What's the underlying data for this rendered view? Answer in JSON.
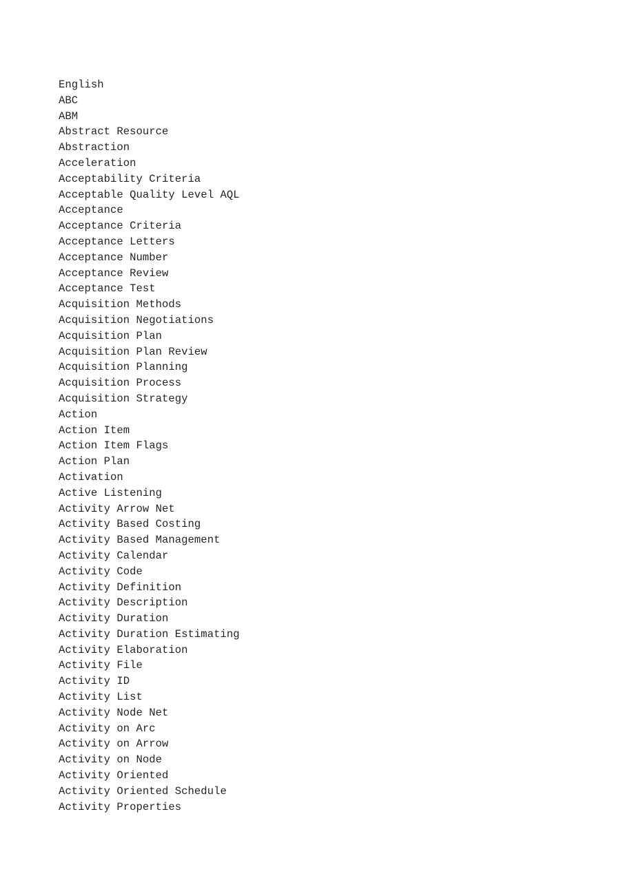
{
  "document": {
    "background_color": "#ffffff",
    "text_color": "#252525",
    "column_header": "English",
    "terms": [
      "English",
      "ABC",
      "ABM",
      "Abstract Resource",
      "Abstraction",
      "Acceleration",
      "Acceptability Criteria",
      "Acceptable Quality Level AQL",
      "Acceptance",
      "Acceptance Criteria",
      "Acceptance Letters",
      "Acceptance Number",
      "Acceptance Review",
      "Acceptance Test",
      "Acquisition Methods",
      "Acquisition Negotiations",
      "Acquisition Plan",
      "Acquisition Plan Review",
      "Acquisition Planning",
      "Acquisition Process",
      "Acquisition Strategy",
      "Action",
      "Action Item",
      "Action Item Flags",
      "Action Plan",
      "Activation",
      "Active Listening",
      "Activity Arrow Net",
      "Activity Based Costing",
      "Activity Based Management",
      "Activity Calendar",
      "Activity Code",
      "Activity Definition",
      "Activity Description",
      "Activity Duration",
      "Activity Duration Estimating",
      "Activity Elaboration",
      "Activity File",
      "Activity ID",
      "Activity List",
      "Activity Node Net",
      "Activity on Arc",
      "Activity on Arrow",
      "Activity on Node",
      "Activity Oriented",
      "Activity Oriented Schedule",
      "Activity Properties"
    ]
  }
}
